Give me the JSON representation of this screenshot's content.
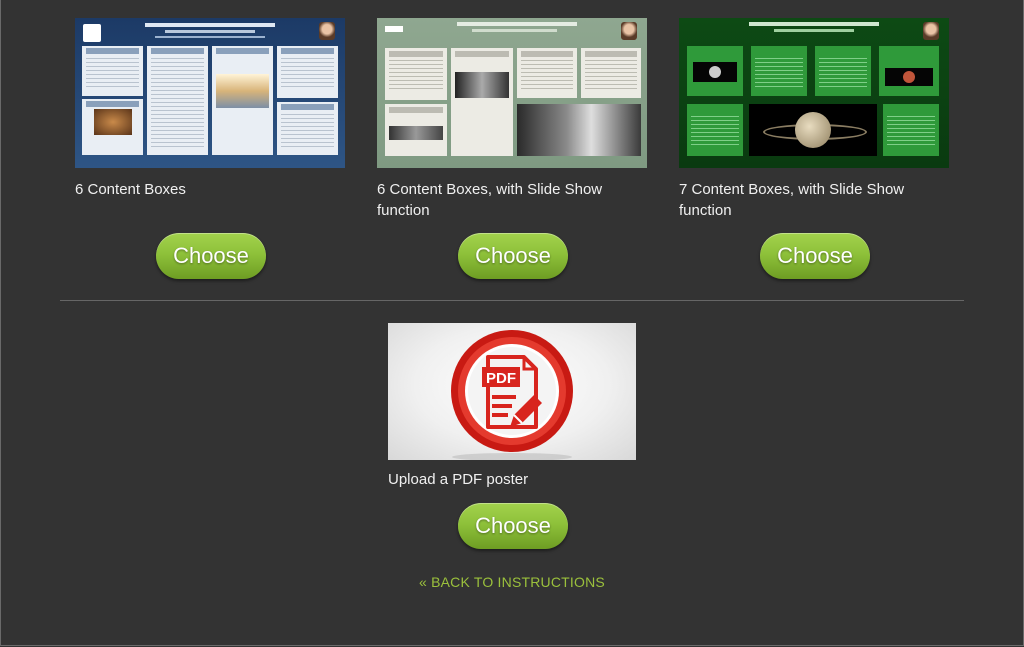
{
  "templates": [
    {
      "caption": "6 Content Boxes",
      "button": "Choose",
      "thumb_color": "#25497a"
    },
    {
      "caption": "6 Content Boxes, with Slide Show function",
      "button": "Choose",
      "thumb_color": "#869f88"
    },
    {
      "caption": "7 Content Boxes, with Slide Show function",
      "button": "Choose",
      "thumb_color": "#0c4412"
    }
  ],
  "upload": {
    "caption": "Upload a PDF poster",
    "button": "Choose",
    "icon": "pdf-document-icon",
    "pdf_text": "PDF"
  },
  "back_link": "« BACK TO INSTRUCTIONS",
  "colors": {
    "background": "#333333",
    "button_green": "#8ec13a",
    "link_green": "#9bc13c",
    "pdf_red": "#d8251e"
  }
}
